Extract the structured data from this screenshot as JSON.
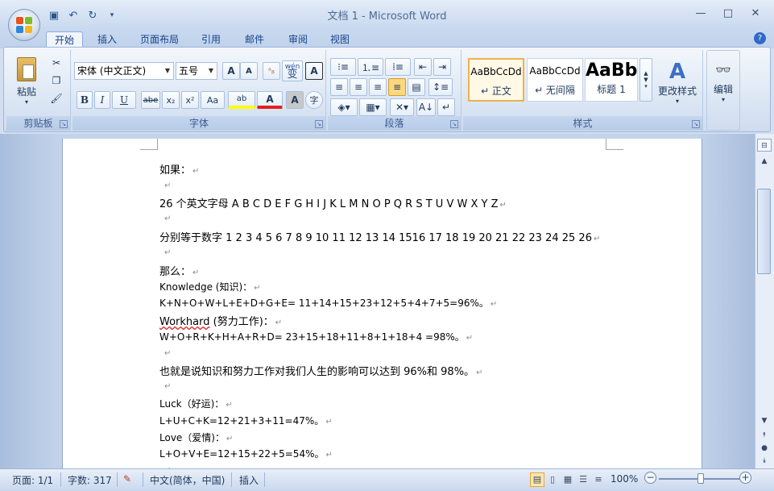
{
  "window": {
    "title": "文档 1 - Microsoft Word",
    "controls": [
      "—",
      "□",
      "✕"
    ]
  },
  "quick_access": {
    "icons": [
      "save-icon",
      "undo-icon",
      "redo-icon",
      "customize-icon"
    ],
    "glyphs": [
      "▣",
      "↶",
      "↻",
      "▾"
    ]
  },
  "tabs": [
    "开始",
    "插入",
    "页面布局",
    "引用",
    "邮件",
    "审阅",
    "视图"
  ],
  "active_tab": 0,
  "ribbon": {
    "clipboard": {
      "label": "剪贴板",
      "paste": "粘贴"
    },
    "font": {
      "label": "字体",
      "family": "宋体 (中文正文)",
      "size": "五号",
      "grow": "A",
      "shrink": "A",
      "clear": "ᵃᵦ",
      "wen": "wén",
      "wen_char": "变",
      "border_char": "A",
      "bold": "B",
      "italic": "I",
      "underline": "U",
      "strike": "abe",
      "sub": "x₂",
      "sup": "x²",
      "case": "Aa",
      "highlight": "ab",
      "color": "A",
      "shade": "A",
      "enclose": "字"
    },
    "paragraph": {
      "label": "段落"
    },
    "styles": {
      "label": "样式",
      "cards": [
        {
          "sample": "AaBbCcDd",
          "name": "↵ 正文"
        },
        {
          "sample": "AaBbCcDd",
          "name": "↵ 无间隔"
        },
        {
          "sample": "AaBb",
          "name": "标题 1"
        }
      ],
      "change": "更改样式"
    },
    "editing": {
      "label": "编辑"
    }
  },
  "document": {
    "lines": [
      {
        "text": "如果：",
        "size": "big"
      },
      {
        "text": "",
        "size": "big"
      },
      {
        "text": "26 个英文字母 A B C D E F G H I J K L M N O P Q R S T U V W X Y Z",
        "size": "big"
      },
      {
        "text": "",
        "size": "big"
      },
      {
        "text": "分别等于数字 1 2 3 4 5 6 7 8 9 10 11 12 13 14 1516 17 18 19 20 21 22 23 24 25 26",
        "size": "big"
      },
      {
        "text": "",
        "size": "big"
      },
      {
        "text": "那么：",
        "size": "big"
      },
      {
        "text": "Knowledge (知识)：",
        "size": "small"
      },
      {
        "text": "K+N+O+W+L+E+D+G+E= 11+14+15+23+12+5+4+7+5=96%。",
        "size": "small"
      },
      {
        "text": "Workhard (努力工作)：",
        "size": "big",
        "squiggle": "Workhard"
      },
      {
        "text": "W+O+R+K+H+A+R+D= 23+15+18+11+8+1+18+4 =98%。",
        "size": "small"
      },
      {
        "text": "",
        "size": "small"
      },
      {
        "text": "也就是说知识和努力工作对我们人生的影响可以达到 96%和 98%。",
        "size": "big"
      },
      {
        "text": "",
        "size": "small"
      },
      {
        "text": "Luck（好运)：",
        "size": "small"
      },
      {
        "text": "L+U+C+K=12+21+3+11=47%。",
        "size": "small"
      },
      {
        "text": "Love（爱情)：",
        "size": "small"
      },
      {
        "text": "L+O+V+E=12+15+22+5=54%。",
        "size": "small"
      },
      {
        "text": "",
        "size": "small"
      }
    ],
    "para_mark": "↵"
  },
  "status": {
    "page": "页面: 1/1",
    "words": "字数: 317",
    "lang": "中文(简体，中国)",
    "mode": "插入",
    "zoom": "100%",
    "zoom_level": 1.0
  }
}
